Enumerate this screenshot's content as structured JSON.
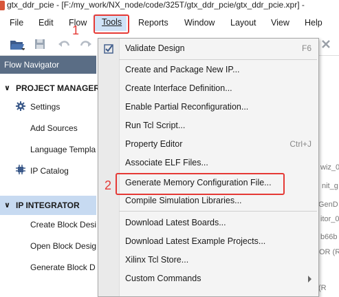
{
  "window": {
    "title": "gtx_ddr_pcie - [F:/my_work/NX_node/code/325T/gtx_ddr_pcie/gtx_ddr_pcie.xpr] -"
  },
  "menubar": {
    "items": [
      "File",
      "Edit",
      "Flow",
      "Tools",
      "Reports",
      "Window",
      "Layout",
      "View",
      "Help"
    ]
  },
  "flow_navigator": {
    "title": "Flow Navigator",
    "project_manager": {
      "label": "PROJECT MANAGER",
      "items": [
        "Settings",
        "Add Sources",
        "Language Templa",
        "IP Catalog"
      ]
    },
    "ip_integrator": {
      "label": "IP INTEGRATOR",
      "items": [
        "Create Block Desi",
        "Open Block Desig",
        "Generate Block D"
      ]
    }
  },
  "right_peek": [
    "wiz_0",
    "nit_g",
    "GenD",
    "itor_0",
    "b66b",
    "OR (RV",
    "(R"
  ],
  "tools_menu": {
    "items": [
      {
        "label": "Validate Design",
        "shortcut": "F6",
        "icon": "validate-check-icon"
      },
      {
        "label": "Create and Package New IP..."
      },
      {
        "label": "Create Interface Definition..."
      },
      {
        "label": "Enable Partial Reconfiguration..."
      },
      {
        "label": "Run Tcl Script..."
      },
      {
        "label": "Property Editor",
        "shortcut": "Ctrl+J"
      },
      {
        "label": "Associate ELF Files..."
      },
      {
        "label": "Generate Memory Configuration File..."
      },
      {
        "label": "Compile Simulation Libraries..."
      },
      {
        "label": "Download Latest Boards..."
      },
      {
        "label": "Download Latest Example Projects..."
      },
      {
        "label": "Xilinx Tcl Store..."
      },
      {
        "label": "Custom Commands",
        "submenu": true
      }
    ]
  },
  "annotations": {
    "step1": "1",
    "step2": "2",
    "color": "#e53935"
  }
}
